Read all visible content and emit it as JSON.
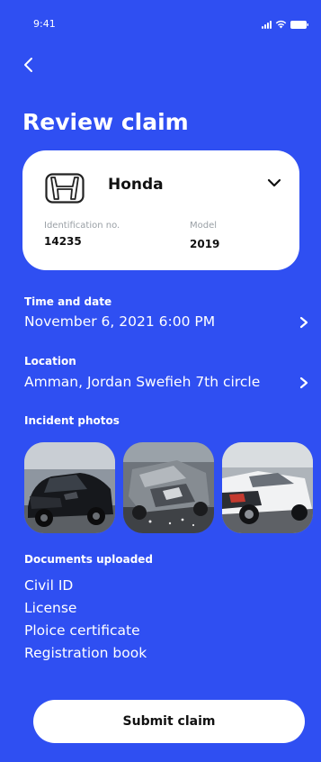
{
  "status_bar": {
    "time": "9:41"
  },
  "header": {
    "back_icon": "chevron-left-icon",
    "title": "Review claim"
  },
  "vehicle": {
    "logo_icon": "honda-logo",
    "name": "Honda",
    "id_label": "Identification no.",
    "id_value": "14235",
    "model_label": "Model",
    "model_value": "2019",
    "expand_icon": "chevron-down-icon"
  },
  "time_and_date": {
    "label": "Time and date",
    "value": "November 6, 2021 6:00 PM"
  },
  "location": {
    "label": "Location",
    "value": "Amman, Jordan Swefieh 7th circle"
  },
  "photos": {
    "label": "Incident photos",
    "items": [
      "damaged-black-car-photo",
      "car-crash-photo",
      "damaged-white-car-photo"
    ]
  },
  "documents": {
    "label": "Documents uploaded",
    "items": [
      "Civil ID",
      "License",
      "Ploice certificate",
      "Registration book"
    ]
  },
  "submit": {
    "label": "Submit claim"
  },
  "colors": {
    "background": "#2f4ff2",
    "card": "#ffffff",
    "text_on_blue": "#ffffff",
    "muted_label": "#9aa0a6"
  }
}
